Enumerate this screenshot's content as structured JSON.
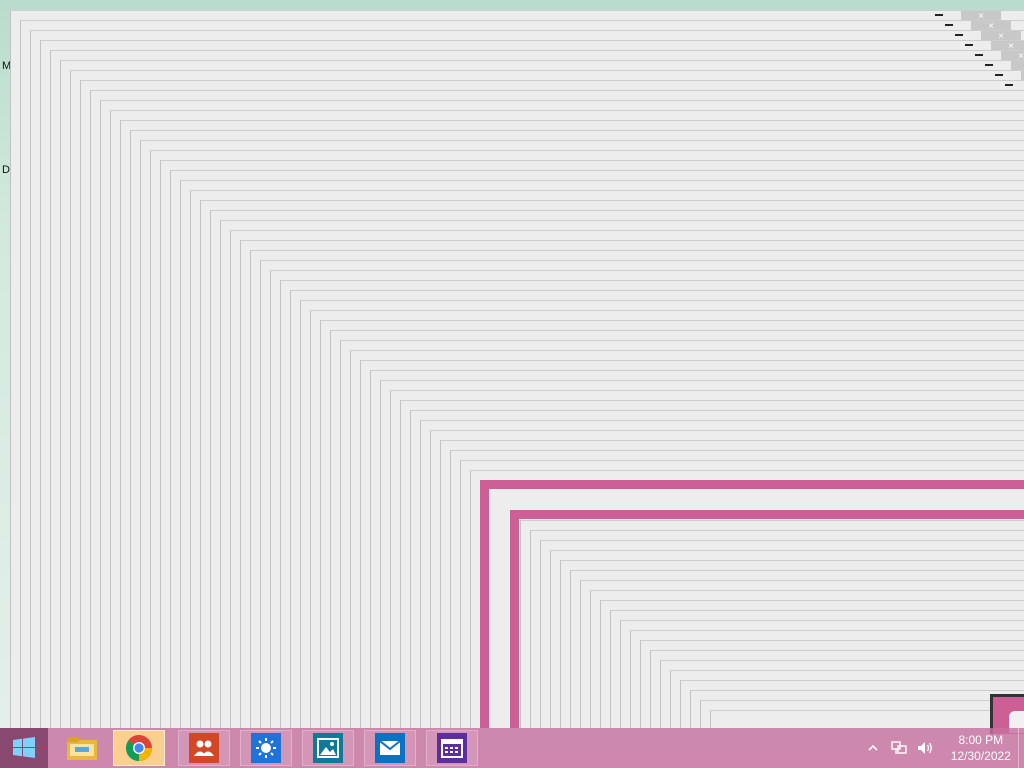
{
  "desktop": {
    "icons": [
      {
        "label": "M"
      },
      {
        "label": "D"
      }
    ]
  },
  "windows": {
    "ghost_trail_count": 70,
    "close_glyph": "×"
  },
  "taskbar": {
    "start": {
      "icon": "windows-logo-icon"
    },
    "pinned": [
      {
        "name": "file-explorer",
        "icon": "folder-icon",
        "color": "#f4c542"
      },
      {
        "name": "google-chrome",
        "icon": "chrome-icon",
        "active": true
      },
      {
        "name": "people",
        "icon": "people-icon",
        "color": "#d24726"
      },
      {
        "name": "weather",
        "icon": "weather-icon",
        "color": "#1e72d8"
      },
      {
        "name": "photos",
        "icon": "photos-icon",
        "color": "#0e7a9a"
      },
      {
        "name": "mail",
        "icon": "mail-icon",
        "color": "#0a72c4"
      },
      {
        "name": "calendar",
        "icon": "calendar-icon",
        "color": "#5b2d9e"
      }
    ],
    "tray": {
      "time": "8:00 PM",
      "date": "12/30/2022"
    }
  },
  "colors": {
    "accent": "#cc5f95",
    "taskbar": "#c870a0",
    "window_ghost": "#ededed"
  }
}
